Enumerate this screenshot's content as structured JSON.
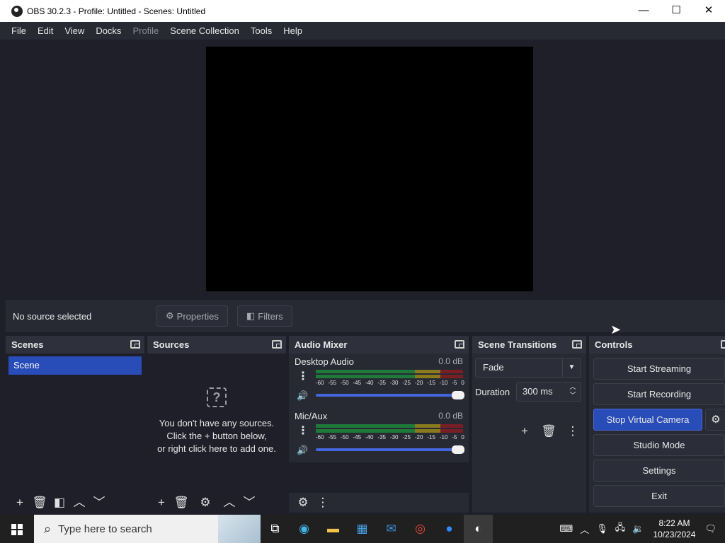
{
  "window": {
    "title": "OBS 30.2.3 - Profile: Untitled - Scenes: Untitled",
    "minimize": "—",
    "maximize": "☐",
    "close": "✕"
  },
  "menu": [
    "File",
    "Edit",
    "View",
    "Docks",
    "Profile",
    "Scene Collection",
    "Tools",
    "Help"
  ],
  "sourcebar": {
    "status": "No source selected",
    "properties_label": "Properties",
    "filters_label": "Filters"
  },
  "scenes": {
    "title": "Scenes",
    "items": [
      "Scene"
    ]
  },
  "sources": {
    "title": "Sources",
    "empty_line1": "You don't have any sources.",
    "empty_line2": "Click the + button below,",
    "empty_line3": "or right click here to add one."
  },
  "mixer": {
    "title": "Audio Mixer",
    "channels": [
      {
        "name": "Desktop Audio",
        "db": "0.0 dB",
        "volume": 1.0
      },
      {
        "name": "Mic/Aux",
        "db": "0.0 dB",
        "volume": 1.0
      }
    ],
    "ticks": [
      "-60",
      "-55",
      "-50",
      "-45",
      "-40",
      "-35",
      "-30",
      "-25",
      "-20",
      "-15",
      "-10",
      "-5",
      "0"
    ]
  },
  "transitions": {
    "title": "Scene Transitions",
    "selected": "Fade",
    "duration_label": "Duration",
    "duration_value": "300 ms"
  },
  "controls": {
    "title": "Controls",
    "start_streaming": "Start Streaming",
    "start_recording": "Start Recording",
    "stop_virtual_camera": "Stop Virtual Camera",
    "studio_mode": "Studio Mode",
    "settings": "Settings",
    "exit": "Exit"
  },
  "taskbar": {
    "search_placeholder": "Type here to search",
    "time": "8:22 AM",
    "date": "10/23/2024"
  },
  "colors": {
    "accent": "#284cb8",
    "meter_green": "#1f7a3a",
    "meter_yellow": "#8a7a1e",
    "meter_red": "#7a1e26"
  }
}
